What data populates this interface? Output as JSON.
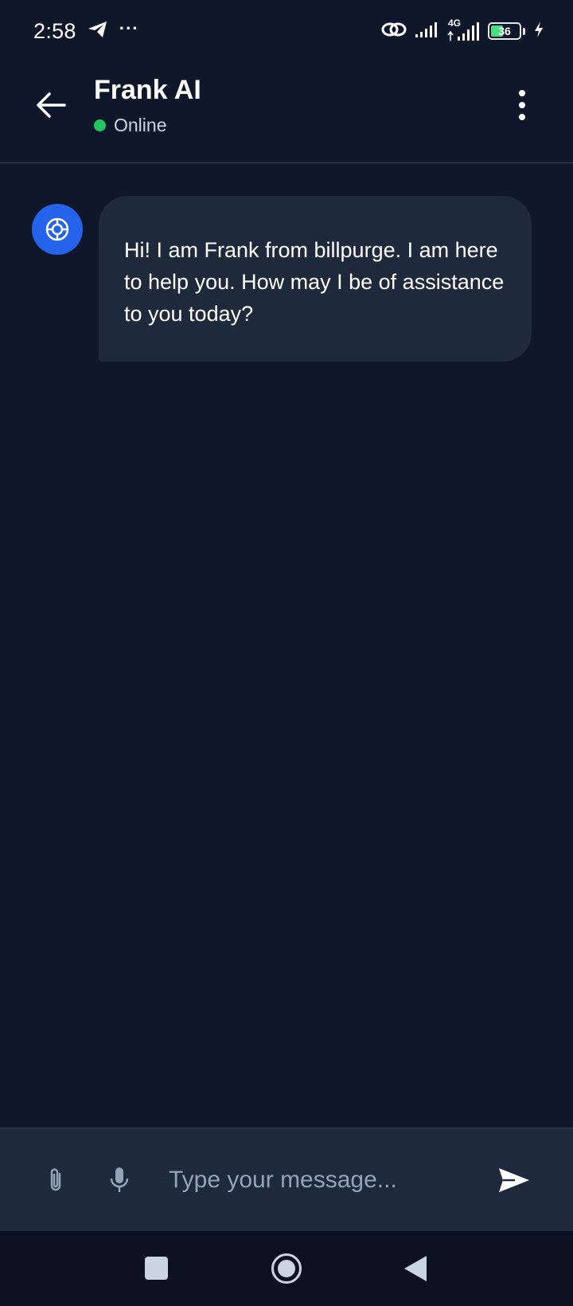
{
  "status_bar": {
    "time": "2:58",
    "more_indicator": "···",
    "network_type": "4G",
    "battery_level": "36",
    "icons": [
      "telegram-icon",
      "link-icon",
      "signal-icon",
      "signal-4g-icon",
      "battery-icon",
      "charging-icon"
    ]
  },
  "header": {
    "title": "Frank AI",
    "status": "Online",
    "status_color": "#22c55e",
    "icons": [
      "back-arrow-icon",
      "more-vertical-icon"
    ]
  },
  "chat": {
    "messages": [
      {
        "sender": "bot",
        "avatar_icon": "lifebuoy-icon",
        "text": "Hi! I am Frank from billpurge. I am here to help you. How may I be of assistance to you today?"
      }
    ]
  },
  "composer": {
    "placeholder": "Type your message...",
    "value": "",
    "icons": [
      "paperclip-icon",
      "microphone-icon",
      "send-icon"
    ]
  },
  "nav_bar": {
    "icons": [
      "recents-square-icon",
      "home-circle-icon",
      "back-triangle-icon"
    ]
  },
  "colors": {
    "background": "#0f172a",
    "surface": "#1e293b",
    "accent": "#2563eb",
    "online": "#22c55e"
  }
}
